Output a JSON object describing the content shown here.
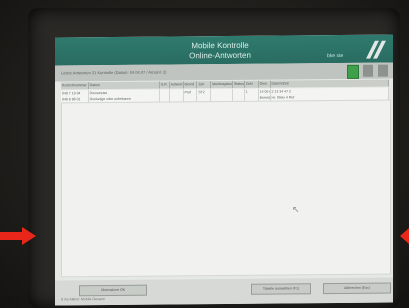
{
  "screen": {
    "title_line1": "Mobile Kontrolle",
    "title_line2": "Online-Antworten",
    "brand": "bke ste",
    "toolbar_text": "Letzte Antworten 21 Kontrolle (Datum: 04.04.07 / Anzahl: 2)",
    "columns": [
      "Kontrollnummer",
      "Datum",
      "S.R.",
      "Antwort",
      "Grund",
      "Zeit",
      "Meldungstext",
      "Status",
      "Zahl",
      "Gem.",
      "Datum/Zeit"
    ],
    "rows": [
      [
        "040 7 19 04",
        "Dienstreise",
        "",
        "",
        "Prüf",
        "ST2",
        "",
        "",
        "1",
        "14 05 07 / 11 41",
        "2 13 34 47 2"
      ],
      [
        "040 8 99 01",
        "Dunkelige oder unbekannt",
        "",
        "",
        "",
        "",
        "",
        "",
        "",
        "Bereich Gleis 1 Halle 1",
        "Hr. Gleis 4 Ruf"
      ]
    ],
    "footer_btn1": "Übernahme OK",
    "footer_btn2": "Tabelle auswählen (F1)",
    "footer_btn3": "Abbrechen (Esc)",
    "status": "0 ms  Aktion: Mobile Gesamt"
  },
  "colors": {
    "title_bar": "#2f7a6e",
    "arrow": "#e8261a"
  }
}
